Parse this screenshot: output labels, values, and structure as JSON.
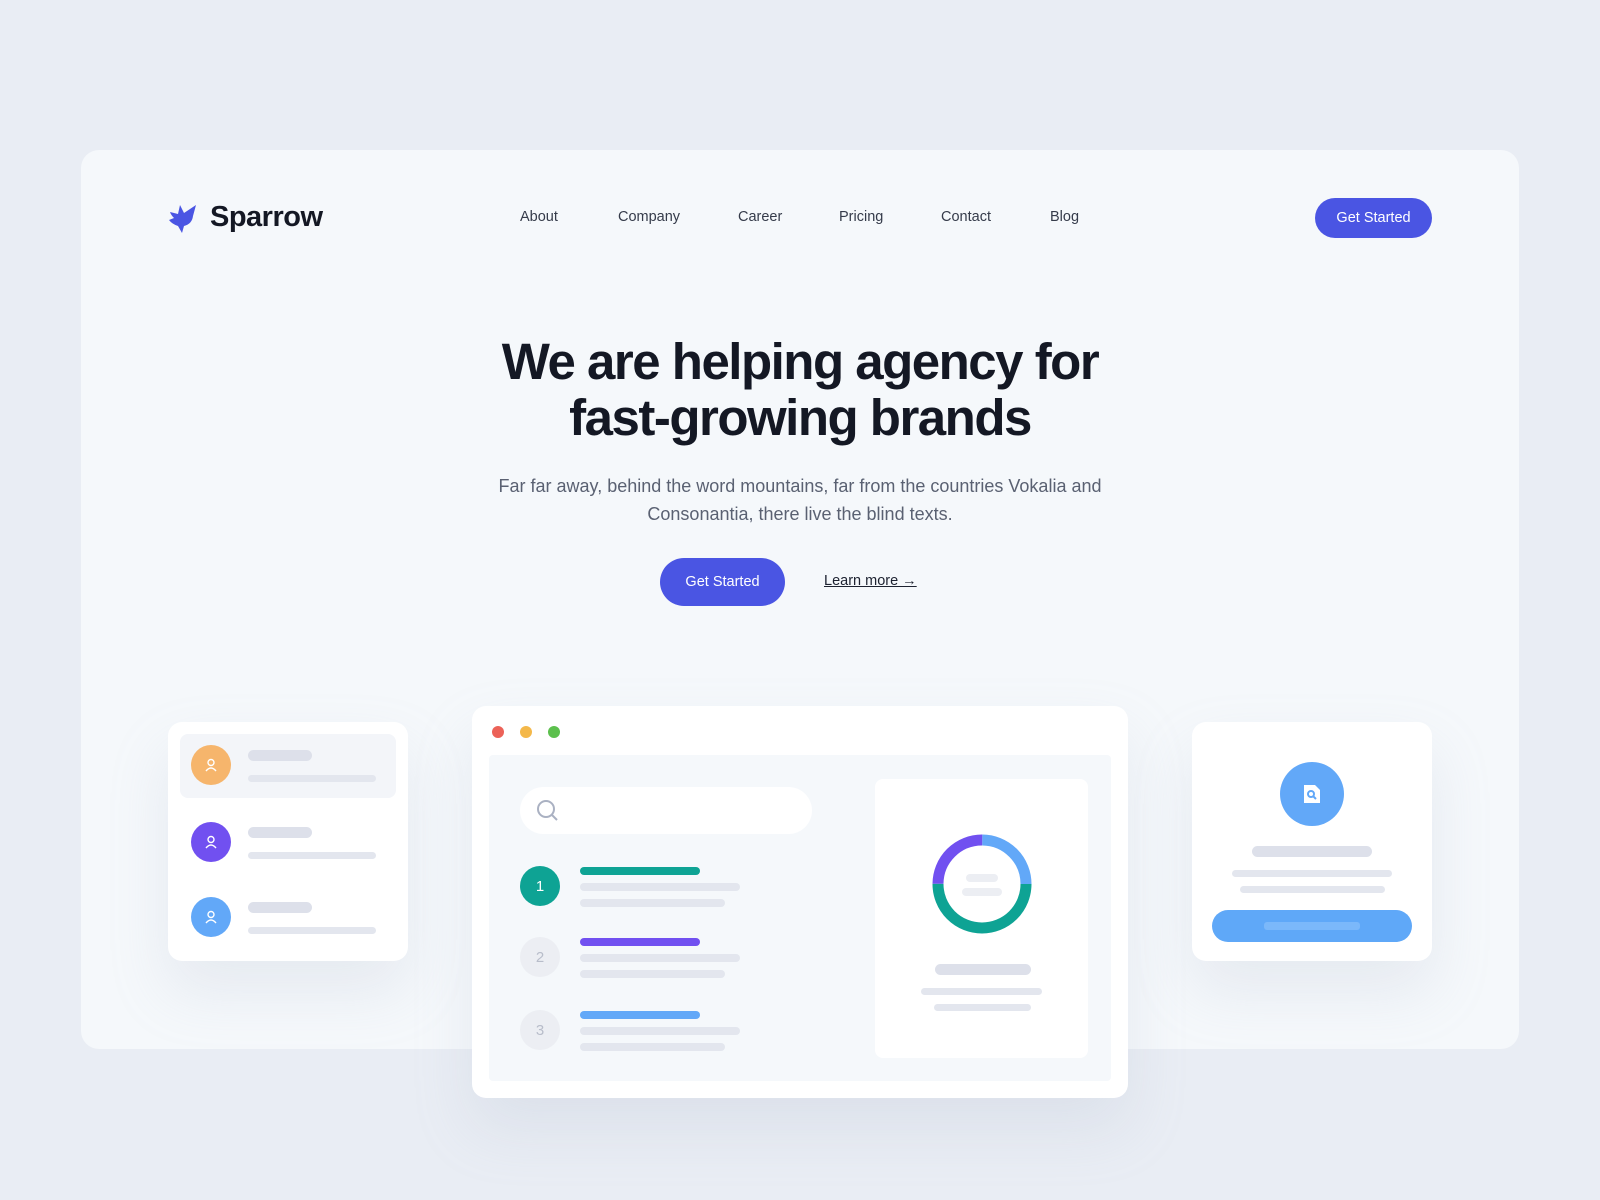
{
  "brand": {
    "name": "Sparrow",
    "color": "#4a55e3"
  },
  "nav": {
    "items": [
      "About",
      "Company",
      "Career",
      "Pricing",
      "Contact",
      "Blog"
    ],
    "cta": "Get Started"
  },
  "hero": {
    "title_line1": "We are helping agency for",
    "title_line2": "fast-growing brands",
    "subtitle": "Far far away, behind the word mountains, far from the countries Vokalia and Consonantia, there live the blind texts.",
    "primary_cta": "Get Started",
    "secondary_cta": "Learn more →"
  },
  "mockup": {
    "steps": [
      {
        "number": "1",
        "color": "#0ea394",
        "active": true
      },
      {
        "number": "2",
        "color": "#7150f0",
        "active": false
      },
      {
        "number": "3",
        "color": "#62a8f8",
        "active": false
      }
    ],
    "donut": {
      "segments": [
        {
          "color": "#0ea394",
          "value": 50
        },
        {
          "color": "#7150f0",
          "value": 25
        },
        {
          "color": "#62a8f8",
          "value": 25
        }
      ]
    },
    "avatars": [
      "#f6b56c",
      "#7150f0",
      "#62a8f8"
    ],
    "window_dots": [
      "#ec6258",
      "#f4b84a",
      "#5cc04d"
    ]
  }
}
